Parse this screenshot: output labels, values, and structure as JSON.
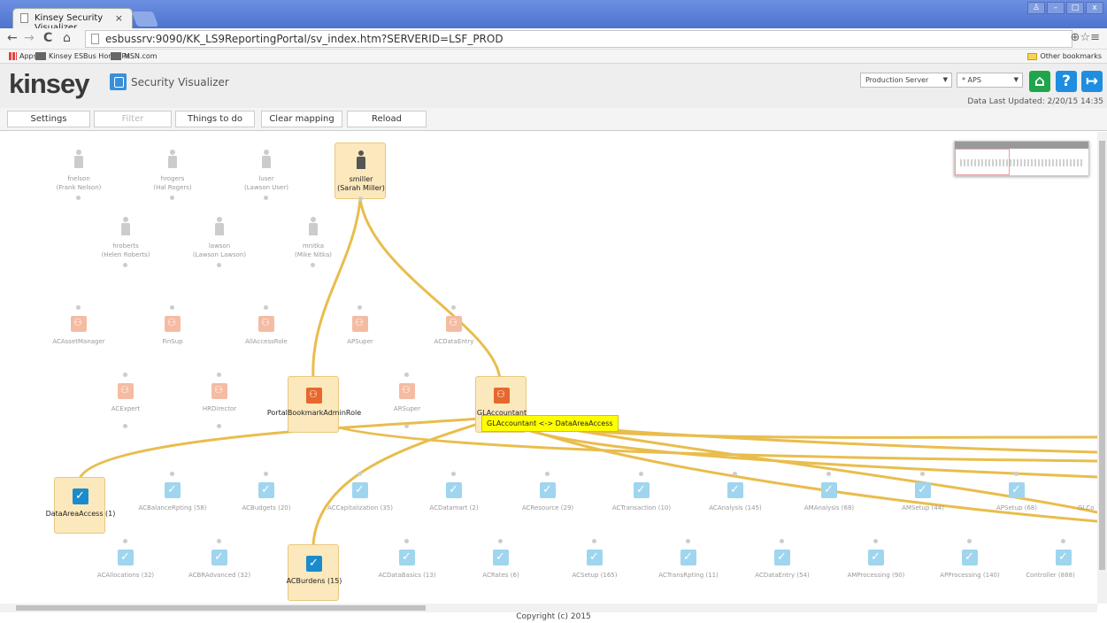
{
  "browser": {
    "tab_title": "Kinsey Security Visualizer",
    "tab_close": "×",
    "url": "esbussrv:9090/KK_LS9ReportingPortal/sv_index.htm?SERVERID=LSF_PROD",
    "bookmarks": [
      "Apps",
      "Kinsey ESBus Home Pa...",
      "MSN.com"
    ],
    "other_bookmarks": "Other bookmarks",
    "back": "←",
    "forward": "→",
    "reload": "C",
    "home": "⌂",
    "zoom_star_menu": "⊕☆≡"
  },
  "header": {
    "logo": "kinsey",
    "app_title": "Security Visualizer",
    "server_select": "Production Server",
    "app_select": "* APS",
    "data_updated": "Data Last Updated: 2/20/15 14:35",
    "help": "?",
    "logout": "↦"
  },
  "toolbar": {
    "settings": "Settings",
    "filter": "Filter",
    "things_to_do": "Things to do",
    "clear_mapping": "Clear mapping",
    "reload": "Reload"
  },
  "users": [
    {
      "id": "fnelson",
      "name": "(Frank Nelson)"
    },
    {
      "id": "hrogers",
      "name": "(Hal Rogers)"
    },
    {
      "id": "luser",
      "name": "(Lawson User)"
    },
    {
      "id": "smiller",
      "name": "(Sarah Miller)"
    },
    {
      "id": "hroberts",
      "name": "(Helen Roberts)"
    },
    {
      "id": "lawson",
      "name": "(Lawson Lawson)"
    },
    {
      "id": "mnitka",
      "name": "(Mike Nitka)"
    }
  ],
  "roles": [
    "ACAssetManager",
    "FinSup",
    "AllAccessRole",
    "APSuper",
    "ACDataEntry",
    "ACExpert",
    "HRDirector",
    "PortalBookmarkAdminRole",
    "ARSuper",
    "GLAccountant"
  ],
  "tables_row1": [
    "DataAreaAccess (1)",
    "ACBalanceRpting (58)",
    "ACBudgets (20)",
    "ACCapitalization (35)",
    "ACDatamart (2)",
    "ACResource (29)",
    "ACTransaction (10)",
    "ACAnalysis (145)",
    "AMAnalysis (68)",
    "AMSetup (44)",
    "APSetup (68)",
    "GLCo"
  ],
  "tables_row2": [
    "ACAllocations (32)",
    "ACBRAdvanced (32)",
    "ACBurdens (15)",
    "ACDataBasics (13)",
    "ACRates (6)",
    "ACSetup (165)",
    "ACTransRpting (11)",
    "ACDataEntry (54)",
    "AMProcessing (90)",
    "APProcessing (140)",
    "Controller (888)"
  ],
  "tooltip": "GLAccountant <-> DataAreaAccess",
  "footer": "Copyright (c) 2015"
}
